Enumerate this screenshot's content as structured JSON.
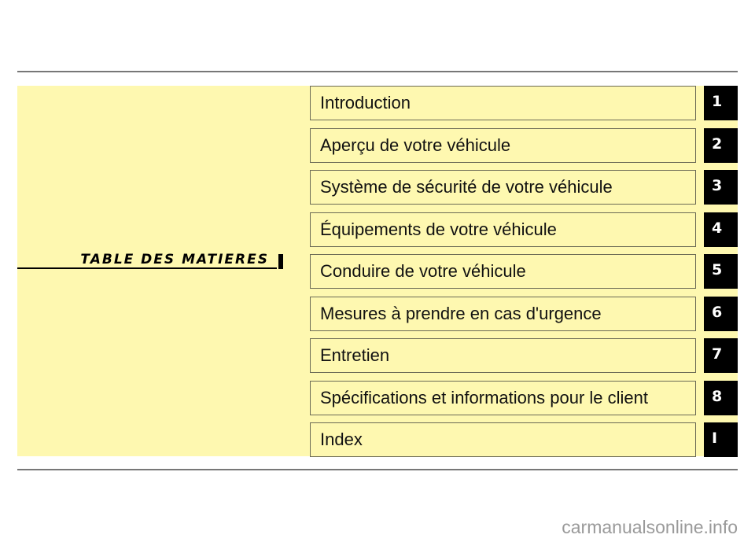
{
  "title": "TABLE DES MATIERES",
  "chapters": [
    {
      "label": "Introduction",
      "tab": "1"
    },
    {
      "label": "Aperçu de votre véhicule",
      "tab": "2"
    },
    {
      "label": "Système de sécurité de votre véhicule",
      "tab": "3"
    },
    {
      "label": "Équipements de votre véhicule",
      "tab": "4"
    },
    {
      "label": "Conduire de votre véhicule",
      "tab": "5"
    },
    {
      "label": "Mesures à prendre en cas d'urgence",
      "tab": "6"
    },
    {
      "label": "Entretien",
      "tab": "7"
    },
    {
      "label": "Spécifications et informations pour le client",
      "tab": "8"
    },
    {
      "label": "Index",
      "tab": "I"
    }
  ],
  "watermark": "carmanualsonline.info",
  "colors": {
    "panel": "#fef8b0",
    "tab": "#000000",
    "tab_text": "#ffffff"
  }
}
